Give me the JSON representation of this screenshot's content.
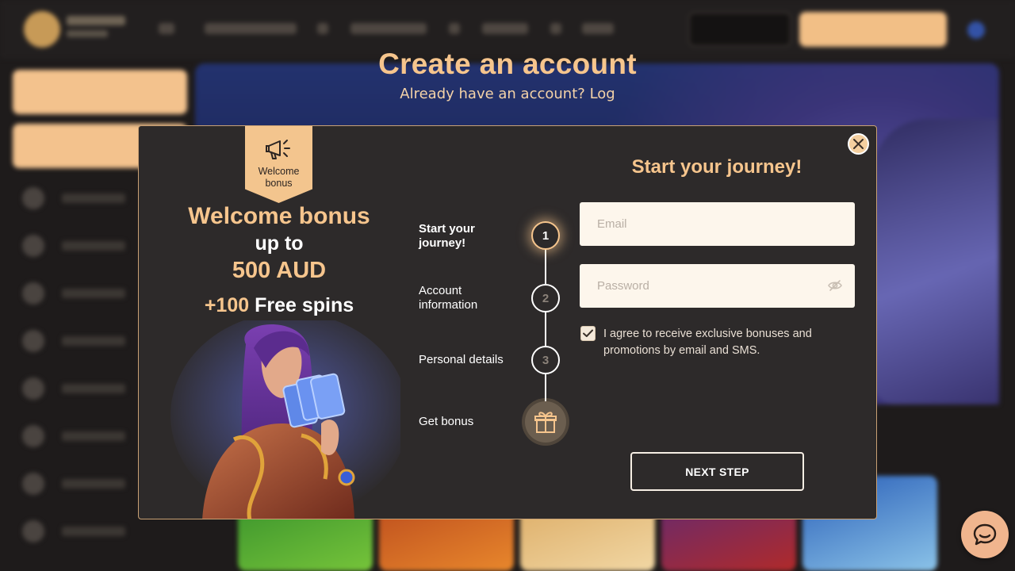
{
  "page": {
    "title": "Create an account",
    "already_text": "Already have an account?",
    "login_link": "Log"
  },
  "modal": {
    "ribbon_label": "Welcome bonus",
    "promo": {
      "title": "Welcome bonus",
      "up_to": "up to",
      "amount": "500 AUD",
      "spins_number": "+100",
      "spins_text": "Free spins"
    },
    "steps": [
      {
        "label": "Start your journey!",
        "number": "1"
      },
      {
        "label": "Account information",
        "number": "2"
      },
      {
        "label": "Personal details",
        "number": "3"
      },
      {
        "label": "Get bonus"
      }
    ],
    "form": {
      "title": "Start your journey!",
      "email_placeholder": "Email",
      "password_placeholder": "Password",
      "agree_text": "I agree to receive exclusive bonuses and promotions by email and SMS.",
      "agree_checked": true,
      "next_label": "NEXT STEP"
    }
  },
  "colors": {
    "accent": "#f6c58d",
    "modal_bg": "#2d2a2a",
    "page_bg": "#1e1b1b",
    "chat": "#f0b58e"
  }
}
